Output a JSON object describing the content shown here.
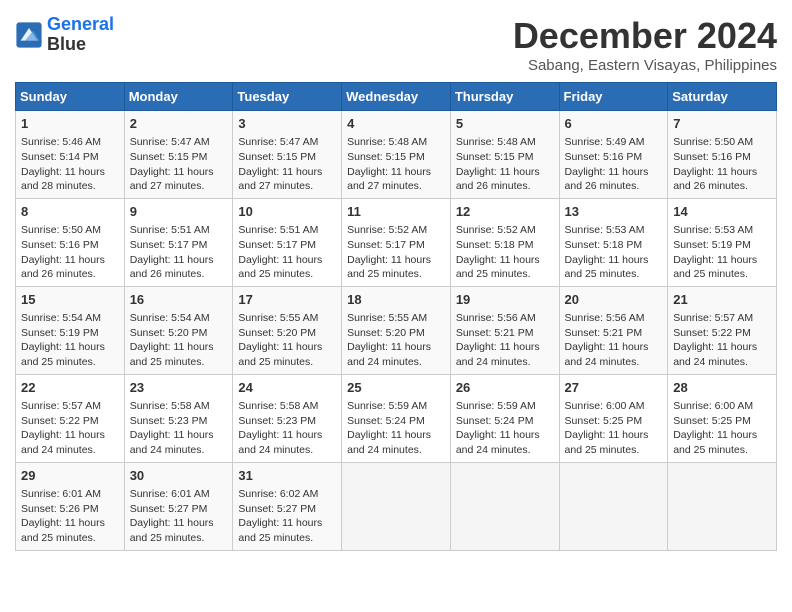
{
  "header": {
    "logo_line1": "General",
    "logo_line2": "Blue",
    "month": "December 2024",
    "location": "Sabang, Eastern Visayas, Philippines"
  },
  "weekdays": [
    "Sunday",
    "Monday",
    "Tuesday",
    "Wednesday",
    "Thursday",
    "Friday",
    "Saturday"
  ],
  "weeks": [
    [
      {
        "day": "1",
        "info": "Sunrise: 5:46 AM\nSunset: 5:14 PM\nDaylight: 11 hours and 28 minutes."
      },
      {
        "day": "2",
        "info": "Sunrise: 5:47 AM\nSunset: 5:15 PM\nDaylight: 11 hours and 27 minutes."
      },
      {
        "day": "3",
        "info": "Sunrise: 5:47 AM\nSunset: 5:15 PM\nDaylight: 11 hours and 27 minutes."
      },
      {
        "day": "4",
        "info": "Sunrise: 5:48 AM\nSunset: 5:15 PM\nDaylight: 11 hours and 27 minutes."
      },
      {
        "day": "5",
        "info": "Sunrise: 5:48 AM\nSunset: 5:15 PM\nDaylight: 11 hours and 26 minutes."
      },
      {
        "day": "6",
        "info": "Sunrise: 5:49 AM\nSunset: 5:16 PM\nDaylight: 11 hours and 26 minutes."
      },
      {
        "day": "7",
        "info": "Sunrise: 5:50 AM\nSunset: 5:16 PM\nDaylight: 11 hours and 26 minutes."
      }
    ],
    [
      {
        "day": "8",
        "info": "Sunrise: 5:50 AM\nSunset: 5:16 PM\nDaylight: 11 hours and 26 minutes."
      },
      {
        "day": "9",
        "info": "Sunrise: 5:51 AM\nSunset: 5:17 PM\nDaylight: 11 hours and 26 minutes."
      },
      {
        "day": "10",
        "info": "Sunrise: 5:51 AM\nSunset: 5:17 PM\nDaylight: 11 hours and 25 minutes."
      },
      {
        "day": "11",
        "info": "Sunrise: 5:52 AM\nSunset: 5:17 PM\nDaylight: 11 hours and 25 minutes."
      },
      {
        "day": "12",
        "info": "Sunrise: 5:52 AM\nSunset: 5:18 PM\nDaylight: 11 hours and 25 minutes."
      },
      {
        "day": "13",
        "info": "Sunrise: 5:53 AM\nSunset: 5:18 PM\nDaylight: 11 hours and 25 minutes."
      },
      {
        "day": "14",
        "info": "Sunrise: 5:53 AM\nSunset: 5:19 PM\nDaylight: 11 hours and 25 minutes."
      }
    ],
    [
      {
        "day": "15",
        "info": "Sunrise: 5:54 AM\nSunset: 5:19 PM\nDaylight: 11 hours and 25 minutes."
      },
      {
        "day": "16",
        "info": "Sunrise: 5:54 AM\nSunset: 5:20 PM\nDaylight: 11 hours and 25 minutes."
      },
      {
        "day": "17",
        "info": "Sunrise: 5:55 AM\nSunset: 5:20 PM\nDaylight: 11 hours and 25 minutes."
      },
      {
        "day": "18",
        "info": "Sunrise: 5:55 AM\nSunset: 5:20 PM\nDaylight: 11 hours and 24 minutes."
      },
      {
        "day": "19",
        "info": "Sunrise: 5:56 AM\nSunset: 5:21 PM\nDaylight: 11 hours and 24 minutes."
      },
      {
        "day": "20",
        "info": "Sunrise: 5:56 AM\nSunset: 5:21 PM\nDaylight: 11 hours and 24 minutes."
      },
      {
        "day": "21",
        "info": "Sunrise: 5:57 AM\nSunset: 5:22 PM\nDaylight: 11 hours and 24 minutes."
      }
    ],
    [
      {
        "day": "22",
        "info": "Sunrise: 5:57 AM\nSunset: 5:22 PM\nDaylight: 11 hours and 24 minutes."
      },
      {
        "day": "23",
        "info": "Sunrise: 5:58 AM\nSunset: 5:23 PM\nDaylight: 11 hours and 24 minutes."
      },
      {
        "day": "24",
        "info": "Sunrise: 5:58 AM\nSunset: 5:23 PM\nDaylight: 11 hours and 24 minutes."
      },
      {
        "day": "25",
        "info": "Sunrise: 5:59 AM\nSunset: 5:24 PM\nDaylight: 11 hours and 24 minutes."
      },
      {
        "day": "26",
        "info": "Sunrise: 5:59 AM\nSunset: 5:24 PM\nDaylight: 11 hours and 24 minutes."
      },
      {
        "day": "27",
        "info": "Sunrise: 6:00 AM\nSunset: 5:25 PM\nDaylight: 11 hours and 25 minutes."
      },
      {
        "day": "28",
        "info": "Sunrise: 6:00 AM\nSunset: 5:25 PM\nDaylight: 11 hours and 25 minutes."
      }
    ],
    [
      {
        "day": "29",
        "info": "Sunrise: 6:01 AM\nSunset: 5:26 PM\nDaylight: 11 hours and 25 minutes."
      },
      {
        "day": "30",
        "info": "Sunrise: 6:01 AM\nSunset: 5:27 PM\nDaylight: 11 hours and 25 minutes."
      },
      {
        "day": "31",
        "info": "Sunrise: 6:02 AM\nSunset: 5:27 PM\nDaylight: 11 hours and 25 minutes."
      },
      {
        "day": "",
        "info": ""
      },
      {
        "day": "",
        "info": ""
      },
      {
        "day": "",
        "info": ""
      },
      {
        "day": "",
        "info": ""
      }
    ]
  ]
}
